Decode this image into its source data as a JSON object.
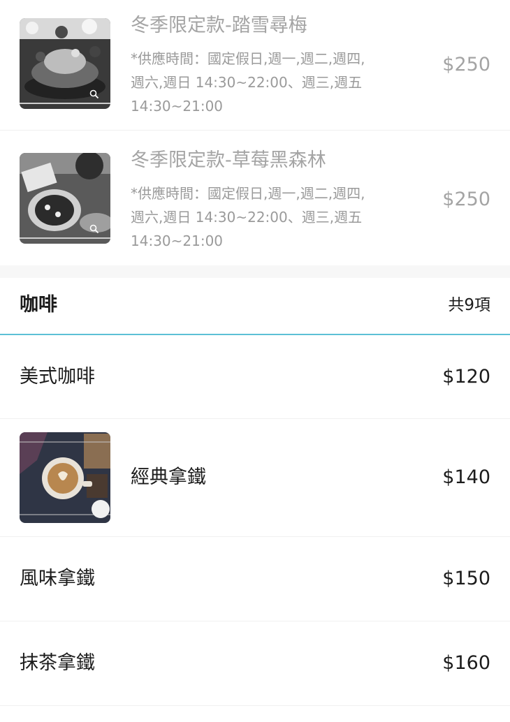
{
  "soldout_items": [
    {
      "name": "冬季限定款-踏雪尋梅",
      "desc_lines": [
        "*供應時間：國定假日,週一,週二,週四,",
        "週六,週日 14:30~22:00、週三,週五",
        "14:30~21:00"
      ],
      "price": "$250",
      "image_icon": "cake-photo"
    },
    {
      "name": "冬季限定款-草莓黑森林",
      "desc_lines": [
        "*供應時間：國定假日,週一,週二,週四,",
        "週六,週日 14:30~22:00、週三,週五",
        "14:30~21:00"
      ],
      "price": "$250",
      "image_icon": "cake-photo"
    }
  ],
  "category": {
    "title": "咖啡",
    "count": "共9項",
    "accent_color": "#5cc0d6"
  },
  "coffee_items": [
    {
      "name": "美式咖啡",
      "price": "$120"
    },
    {
      "name": "經典拿鐵",
      "price": "$140",
      "image_icon": "latte-photo"
    },
    {
      "name": "風味拿鐵",
      "price": "$150"
    },
    {
      "name": "抹茶拿鐵",
      "price": "$160"
    }
  ]
}
